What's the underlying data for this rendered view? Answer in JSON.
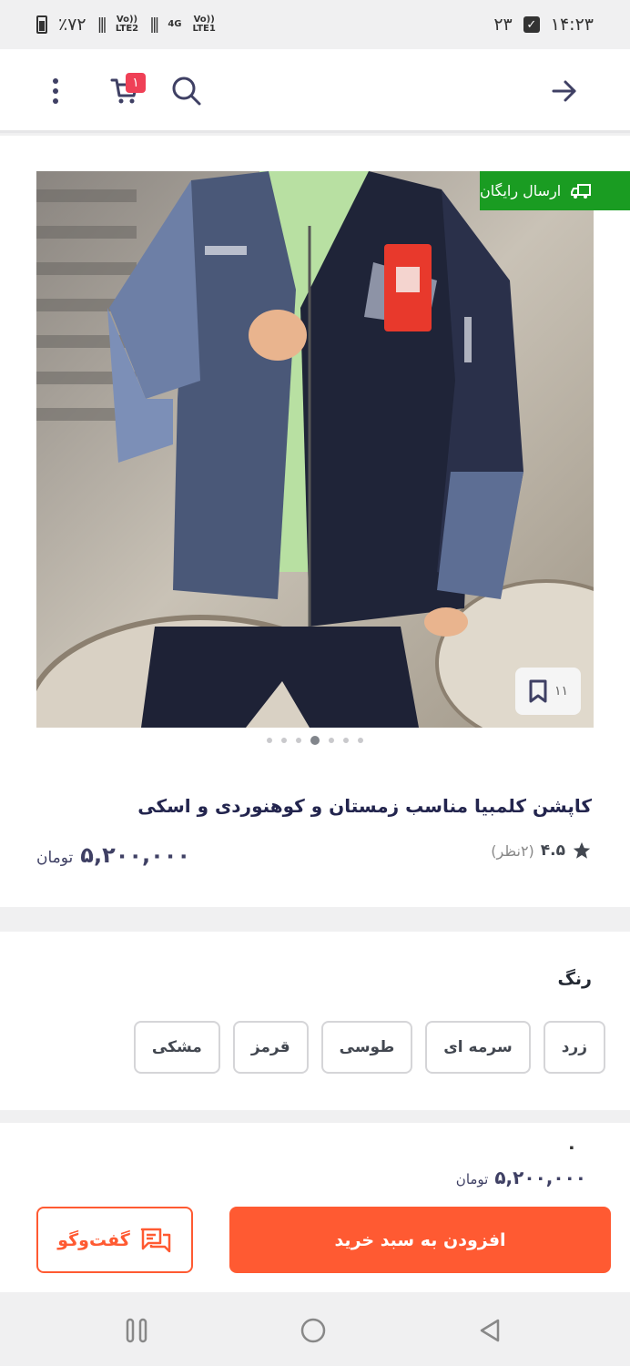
{
  "status_bar": {
    "battery": "٪۷۲",
    "network_1": "Vo))\nLTE2",
    "network_2": "4G",
    "network_3": "Vo))\nLTE1",
    "time": "۱۴:۲۳",
    "notification_count": "۲۳"
  },
  "header": {
    "cart_count": "۱"
  },
  "product": {
    "free_shipping_label": "ارسال رایگان",
    "bookmark_count": "۱۱",
    "image_count": 7,
    "active_image_index": 3,
    "title": "کاپشن کلمبیا مناسب زمستان و کوهنوردی و اسکی",
    "rating_score": "۴.۵",
    "rating_count": "(۲نظر)",
    "price": "۵,۲۰۰,۰۰۰",
    "currency": "تومان"
  },
  "colors": {
    "label": "رنگ",
    "options": [
      "زرد",
      "سرمه ای",
      "طوسی",
      "قرمز",
      "مشکی"
    ]
  },
  "buy_bar": {
    "mini_text": "۰",
    "price": "۵,۲۰۰,۰۰۰",
    "currency": "تومان",
    "add_to_cart": "افزودن به سبد خرید",
    "chat": "گفت‌وگو"
  },
  "theme": {
    "accent": "#ff5a32",
    "free_shipping_green": "#1a9c22"
  }
}
